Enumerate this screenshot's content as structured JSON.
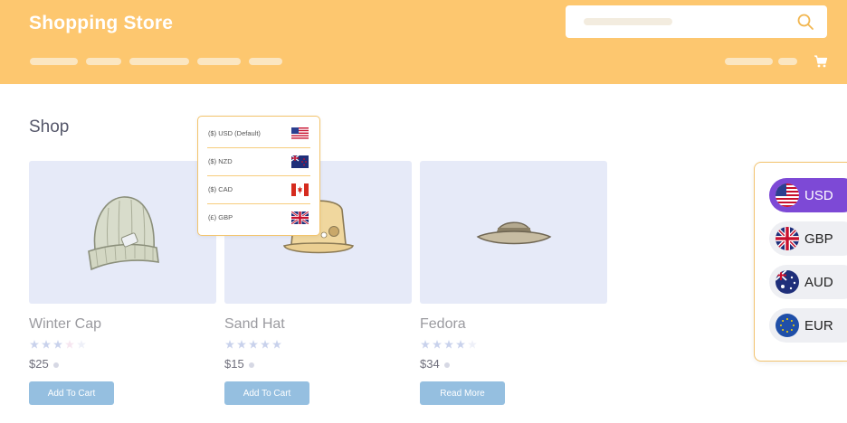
{
  "header": {
    "store_title": "Shopping Store",
    "search_icon": "search-icon",
    "cart_icon": "cart-icon",
    "background_color": "#fdc76f"
  },
  "main": {
    "heading": "Shop"
  },
  "products": [
    {
      "name": "Winter Cap",
      "price": "$25",
      "rating": 3,
      "button_label": "Add To Cart",
      "image": "winter-cap-image"
    },
    {
      "name": "Sand Hat",
      "price": "$15",
      "rating": 5,
      "button_label": "Add To Cart",
      "image": "sand-hat-image"
    },
    {
      "name": "Fedora",
      "price": "$34",
      "rating": 4,
      "button_label": "Read More",
      "image": "fedora-image"
    }
  ],
  "currency_dropdown": {
    "items": [
      {
        "label": "($) USD (Default)",
        "flag": "us-flag-icon"
      },
      {
        "label": "($) NZD",
        "flag": "nz-flag-icon"
      },
      {
        "label": "($) CAD",
        "flag": "ca-flag-icon"
      },
      {
        "label": "(£) GBP",
        "flag": "gb-flag-icon"
      }
    ]
  },
  "currency_switcher": {
    "items": [
      {
        "code": "USD",
        "flag": "us-flag-icon",
        "active": true
      },
      {
        "code": "GBP",
        "flag": "gb-flag-icon",
        "active": false
      },
      {
        "code": "AUD",
        "flag": "au-flag-icon",
        "active": false
      },
      {
        "code": "EUR",
        "flag": "eu-flag-icon",
        "active": false
      }
    ],
    "active_color": "#7d49d6"
  }
}
